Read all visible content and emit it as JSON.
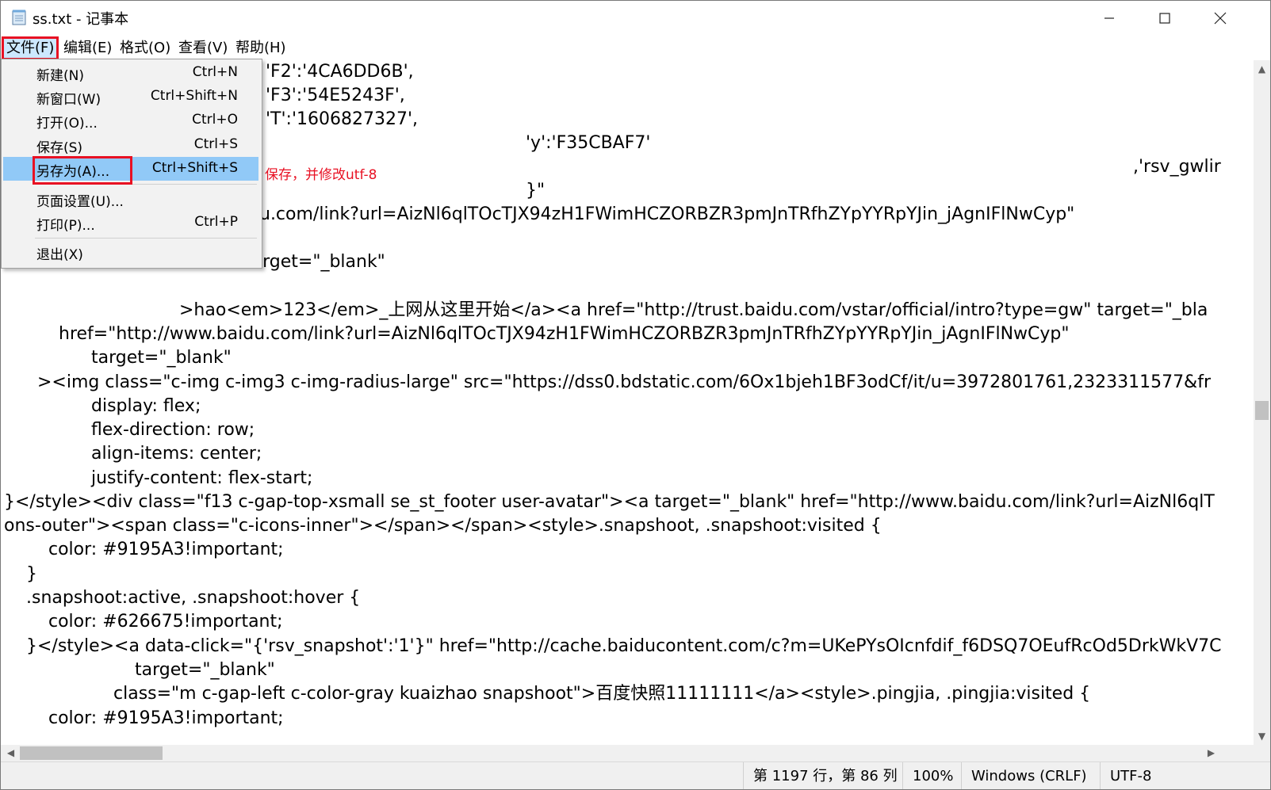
{
  "window": {
    "title": "ss.txt - 记事本"
  },
  "menu": [
    "文件(F)",
    "编辑(E)",
    "格式(O)",
    "查看(V)",
    "帮助(H)"
  ],
  "file_menu": {
    "new": {
      "label": "新建(N)",
      "shortcut": "Ctrl+N"
    },
    "new_window": {
      "label": "新窗口(W)",
      "shortcut": "Ctrl+Shift+N"
    },
    "open": {
      "label": "打开(O)...",
      "shortcut": "Ctrl+O"
    },
    "save": {
      "label": "保存(S)",
      "shortcut": "Ctrl+S"
    },
    "save_as": {
      "label": "另存为(A)...",
      "shortcut": "Ctrl+Shift+S"
    },
    "page_setup": {
      "label": "页面设置(U)...",
      "shortcut": ""
    },
    "print": {
      "label": "打印(P)...",
      "shortcut": "Ctrl+P"
    },
    "exit": {
      "label": "退出(X)",
      "shortcut": ""
    }
  },
  "annotation": "保存，并修改utf-8",
  "editor_lines": [
    "'F2':'4CA6DD6B',",
    "'F3':'54E5243F',",
    "'T':'1606827327',",
    "'y':'F35CBAF7'",
    ",'rsv_gwlir",
    "}\"",
    "u.com/link?url=AizNl6qlTOcTJX94zH1FWimHCZORBZR3pmJnTRfhZYpYYRpYJin_jAgnIFlNwCyp\"",
    "target=\"_blank\"",
    ">hao<em>123</em>_上网从这里开始</a><a href=\"http://trust.baidu.com/vstar/official/intro?type=gw\" target=\"_bla",
    "href=\"http://www.baidu.com/link?url=AizNl6qlTOcTJX94zH1FWimHCZORBZR3pmJnTRfhZYpYYRpYJin_jAgnIFlNwCyp\"",
    "target=\"_blank\"",
    "><img class=\"c-img c-img3 c-img-radius-large\" src=\"https://dss0.bdstatic.com/6Ox1bjeh1BF3odCf/it/u=3972801761,2323311577&fr",
    "display: flex;",
    "flex-direction: row;",
    "align-items: center;",
    "justify-content: flex-start;",
    "}</style><div class=\"f13 c-gap-top-xsmall se_st_footer user-avatar\"><a target=\"_blank\" href=\"http://www.baidu.com/link?url=AizNl6qlT",
    "ons-outer\"><span class=\"c-icons-inner\"></span></span><style>.snapshoot, .snapshoot:visited {",
    "color: #9195A3!important;",
    "}",
    ".snapshoot:active, .snapshoot:hover {",
    "color: #626675!important;",
    "}</style><a data-click=\"{'rsv_snapshot':'1'}\" href=\"http://cache.baiducontent.com/c?m=UKePYsOIcnfdif_f6DSQ7OEufRcOd5DrkWkV7C",
    "target=\"_blank\"",
    "class=\"m c-gap-left c-color-gray kuaizhao snapshoot\">百度快照11111111</a><style>.pingjia, .pingjia:visited {",
    "color: #9195A3!important;"
  ],
  "status": {
    "position": "第 1197 行，第 86 列",
    "zoom": "100%",
    "line_ending": "Windows (CRLF)",
    "encoding": "UTF-8"
  }
}
